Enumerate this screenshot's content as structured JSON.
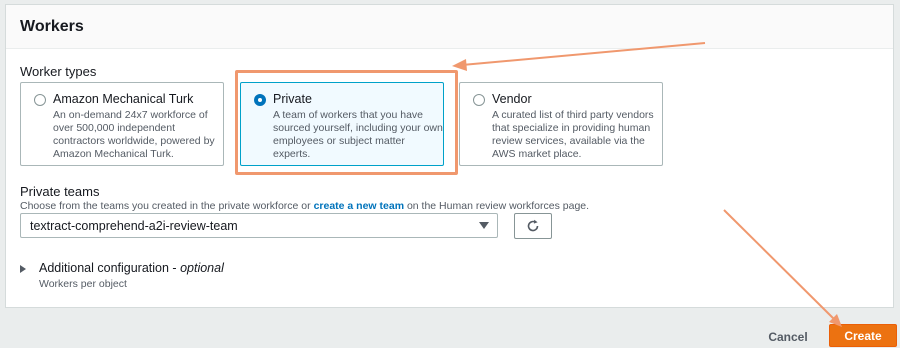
{
  "header": {
    "title": "Workers"
  },
  "worker_types": {
    "label": "Worker types",
    "options": [
      {
        "title": "Amazon Mechanical Turk",
        "desc_lines": [
          "An on-demand 24x7 workforce of",
          "over 500,000 independent",
          "contractors worldwide, powered by",
          "Amazon Mechanical Turk."
        ],
        "selected": false
      },
      {
        "title": "Private",
        "desc_lines": [
          "A team of workers that you have",
          "sourced yourself, including your own",
          "employees or subject matter experts."
        ],
        "selected": true
      },
      {
        "title": "Vendor",
        "desc_lines": [
          "A curated list of third party vendors",
          "that specialize in providing human",
          "review services, available via the",
          "AWS market place."
        ],
        "selected": false
      }
    ]
  },
  "private_teams": {
    "label": "Private teams",
    "helper_before": "Choose from the teams you created in the private workforce or ",
    "helper_link": "create a new team",
    "helper_after": " on the Human review workforces page.",
    "selected_value": "textract-comprehend-a2i-review-team"
  },
  "additional_config": {
    "title": "Additional configuration - ",
    "title_optional": "optional",
    "subtitle": "Workers per object"
  },
  "footer": {
    "cancel_label": "Cancel",
    "create_label": "Create"
  },
  "colors": {
    "accent": "#0073bb",
    "primary_button": "#ec7211",
    "annotation": "#f0986e"
  },
  "icons": {
    "refresh": "refresh-icon",
    "dropdown": "caret-down-icon",
    "expand": "caret-right-icon"
  }
}
